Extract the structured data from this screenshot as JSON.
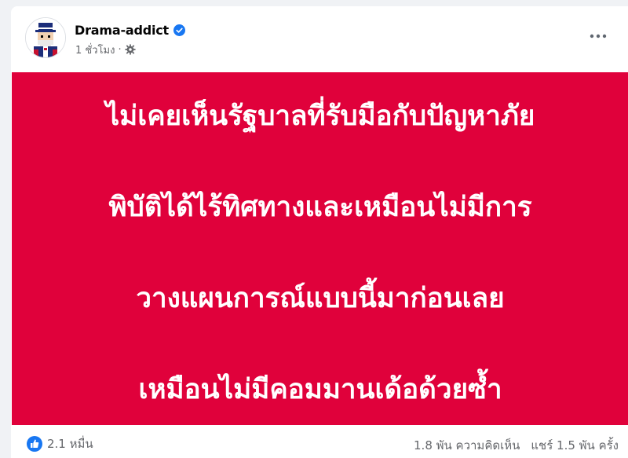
{
  "post": {
    "author": "Drama-addict",
    "verified": true,
    "timestamp": "1 ชั่วโมง",
    "meta_separator": "·",
    "privacy_icon": "gear-icon",
    "more_icon": "more-horizontal-icon",
    "content_lines": [
      "ไม่เคยเห็นรัฐบาลที่รับมือกับปัญหาภัย",
      "พิบัติได้ไร้ทิศทางและเหมือนไม่มีการ",
      "วางแผนการณ์แบบนี้มาก่อนเลย",
      "เหมือนไม่มีคอมมานเด้อด้วยซ้ำ"
    ],
    "background_color": "#e0013b"
  },
  "footer": {
    "reaction_icon": "like-icon",
    "reaction_count": "2.1 หมื่น",
    "comments": "1.8 พัน ความคิดเห็น",
    "shares": "แชร์ 1.5 พัน ครั้ง"
  },
  "colors": {
    "accent": "#1877f2",
    "muted_text": "#65676b"
  }
}
